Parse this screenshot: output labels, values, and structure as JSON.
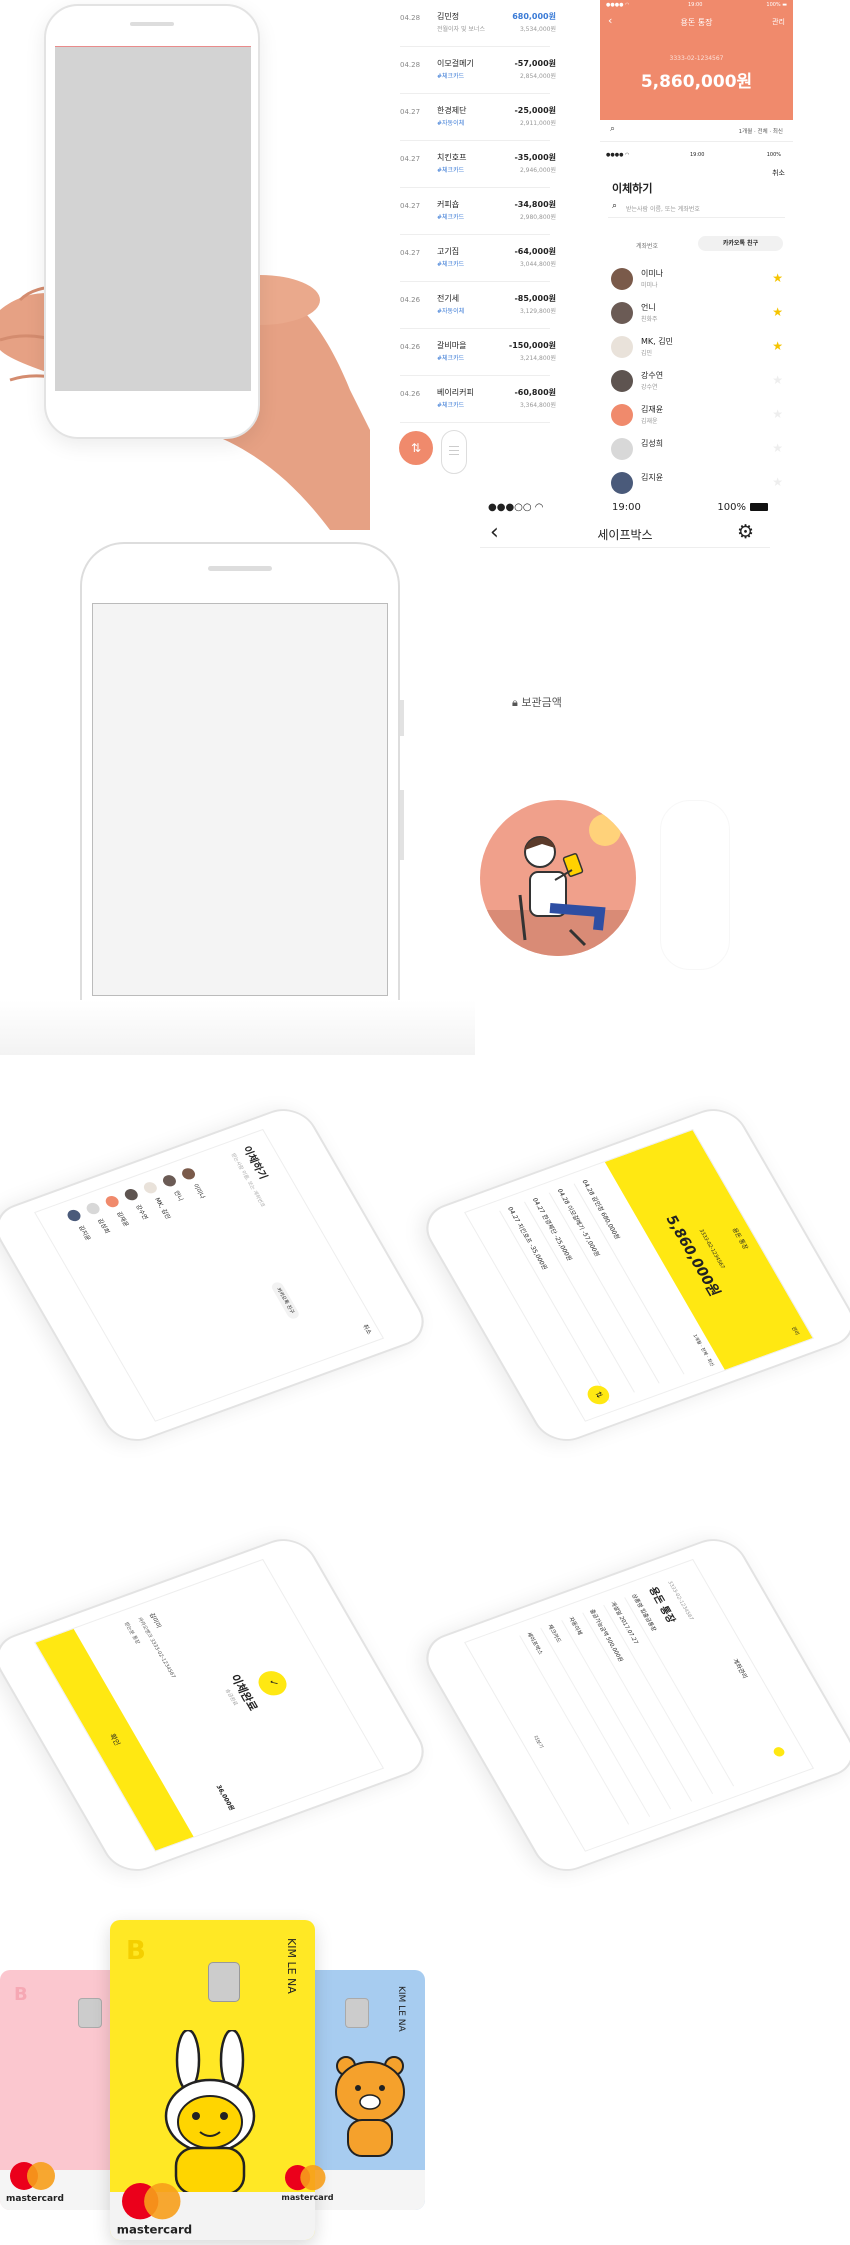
{
  "account": {
    "title": "용돈 통장",
    "manage": "관리",
    "number": "3333-02-1234567",
    "balance": "5,860,000원",
    "filter": "1개월 · 전체 · 최신"
  },
  "transactions": [
    {
      "date": "04.28",
      "name": "김민정",
      "sub": "전월이자 및 보너스",
      "amount": "680,000원",
      "balance": "3,534,000원",
      "income": true
    },
    {
      "date": "04.28",
      "name": "이모걸메기",
      "sub": "#체크카드",
      "amount": "-57,000원",
      "balance": "2,854,000원"
    },
    {
      "date": "04.27",
      "name": "한경제단",
      "sub": "#자동이체",
      "amount": "-25,000원",
      "balance": "2,911,000원"
    },
    {
      "date": "04.27",
      "name": "치킨호프",
      "sub": "#체크카드",
      "amount": "-35,000원",
      "balance": "2,946,000원"
    },
    {
      "date": "04.27",
      "name": "커피숍",
      "sub": "#체크카드",
      "amount": "-34,800원",
      "balance": "2,980,800원"
    },
    {
      "date": "04.27",
      "name": "고기집",
      "sub": "#체크카드",
      "amount": "-64,000원",
      "balance": "3,044,800원"
    },
    {
      "date": "04.26",
      "name": "전기세",
      "sub": "#자동이체",
      "amount": "-85,000원",
      "balance": "3,129,800원"
    },
    {
      "date": "04.26",
      "name": "갈비마을",
      "sub": "#체크카드",
      "amount": "-150,000원",
      "balance": "3,214,800원"
    },
    {
      "date": "04.26",
      "name": "베이리커피",
      "sub": "#체크카드",
      "amount": "-60,800원",
      "balance": "3,364,800원"
    }
  ],
  "transfer": {
    "status_time": "19:00",
    "status_batt": "100%",
    "cancel": "취소",
    "title": "이체하기",
    "search_placeholder": "받는사람 이름, 또는 계좌번호",
    "tab_account": "계좌번호",
    "tab_friends": "카카오톡 친구",
    "friends": [
      {
        "name": "이미나",
        "sub": "미미나",
        "star": true
      },
      {
        "name": "언니",
        "sub": "친화주",
        "star": true
      },
      {
        "name": "MK, 김민",
        "sub": "김민",
        "star": true
      },
      {
        "name": "강수연",
        "sub": "강수연",
        "star": false
      },
      {
        "name": "김재윤",
        "sub": "김재윤",
        "star": false
      },
      {
        "name": "김성희",
        "sub": "",
        "star": false
      },
      {
        "name": "김지윤",
        "sub": "",
        "star": false
      }
    ]
  },
  "safebox": {
    "time": "19:00",
    "battery": "100%",
    "title": "세이프박스",
    "stored_label": "보관금액"
  },
  "tilted": {
    "p1_title": "이체하기",
    "p1_search": "받는사람 이름, 또는 계좌번호",
    "p1_cancel": "취소",
    "p1_tab": "카카오톡 친구",
    "p1_names": [
      "이미나",
      "언니",
      "MK, 김민",
      "강수연",
      "김재윤",
      "김성희",
      "김지윤"
    ],
    "p2_title": "용돈 통장",
    "p2_manage": "관리",
    "p2_number": "3333-02-1234567",
    "p2_balance": "5,860,000원",
    "p2_filter": "1개월 · 전체 · 최신",
    "p2_rows": [
      "04.28 김민정 680,000원",
      "04.28 이모걸메기 -57,000원",
      "04.27 한경제단 -25,000원",
      "04.27 치킨호프 -35,000원"
    ],
    "p3_title": "이체완료",
    "p3_sub": "송금완료",
    "p3_name": "김미미",
    "p3_bank": "카카오뱅크 3333-02-1234567",
    "p3_amount": "36,000원",
    "p3_memo": "받는분 통장",
    "p3_confirm": "확인",
    "p4_head": "계좌관리",
    "p4_title": "용돈 통장",
    "p4_number": "3333-02-1234567",
    "p4_rows": [
      "상품명 입출금통장",
      "개설일 2017.07.27",
      "출금가능금액 500,000원",
      "자동이체",
      "체크카드",
      "세이프박스"
    ],
    "p4_more": "더보기"
  },
  "cards": {
    "holder": "KIM LE NA",
    "brand": "mastercard"
  },
  "colors": {
    "coral": "#f08a6c",
    "kakao_yellow": "#ffe812",
    "card_pink": "#fbc7cf",
    "card_blue": "#a7ccf0",
    "blue_amount": "#3b7bd6"
  }
}
